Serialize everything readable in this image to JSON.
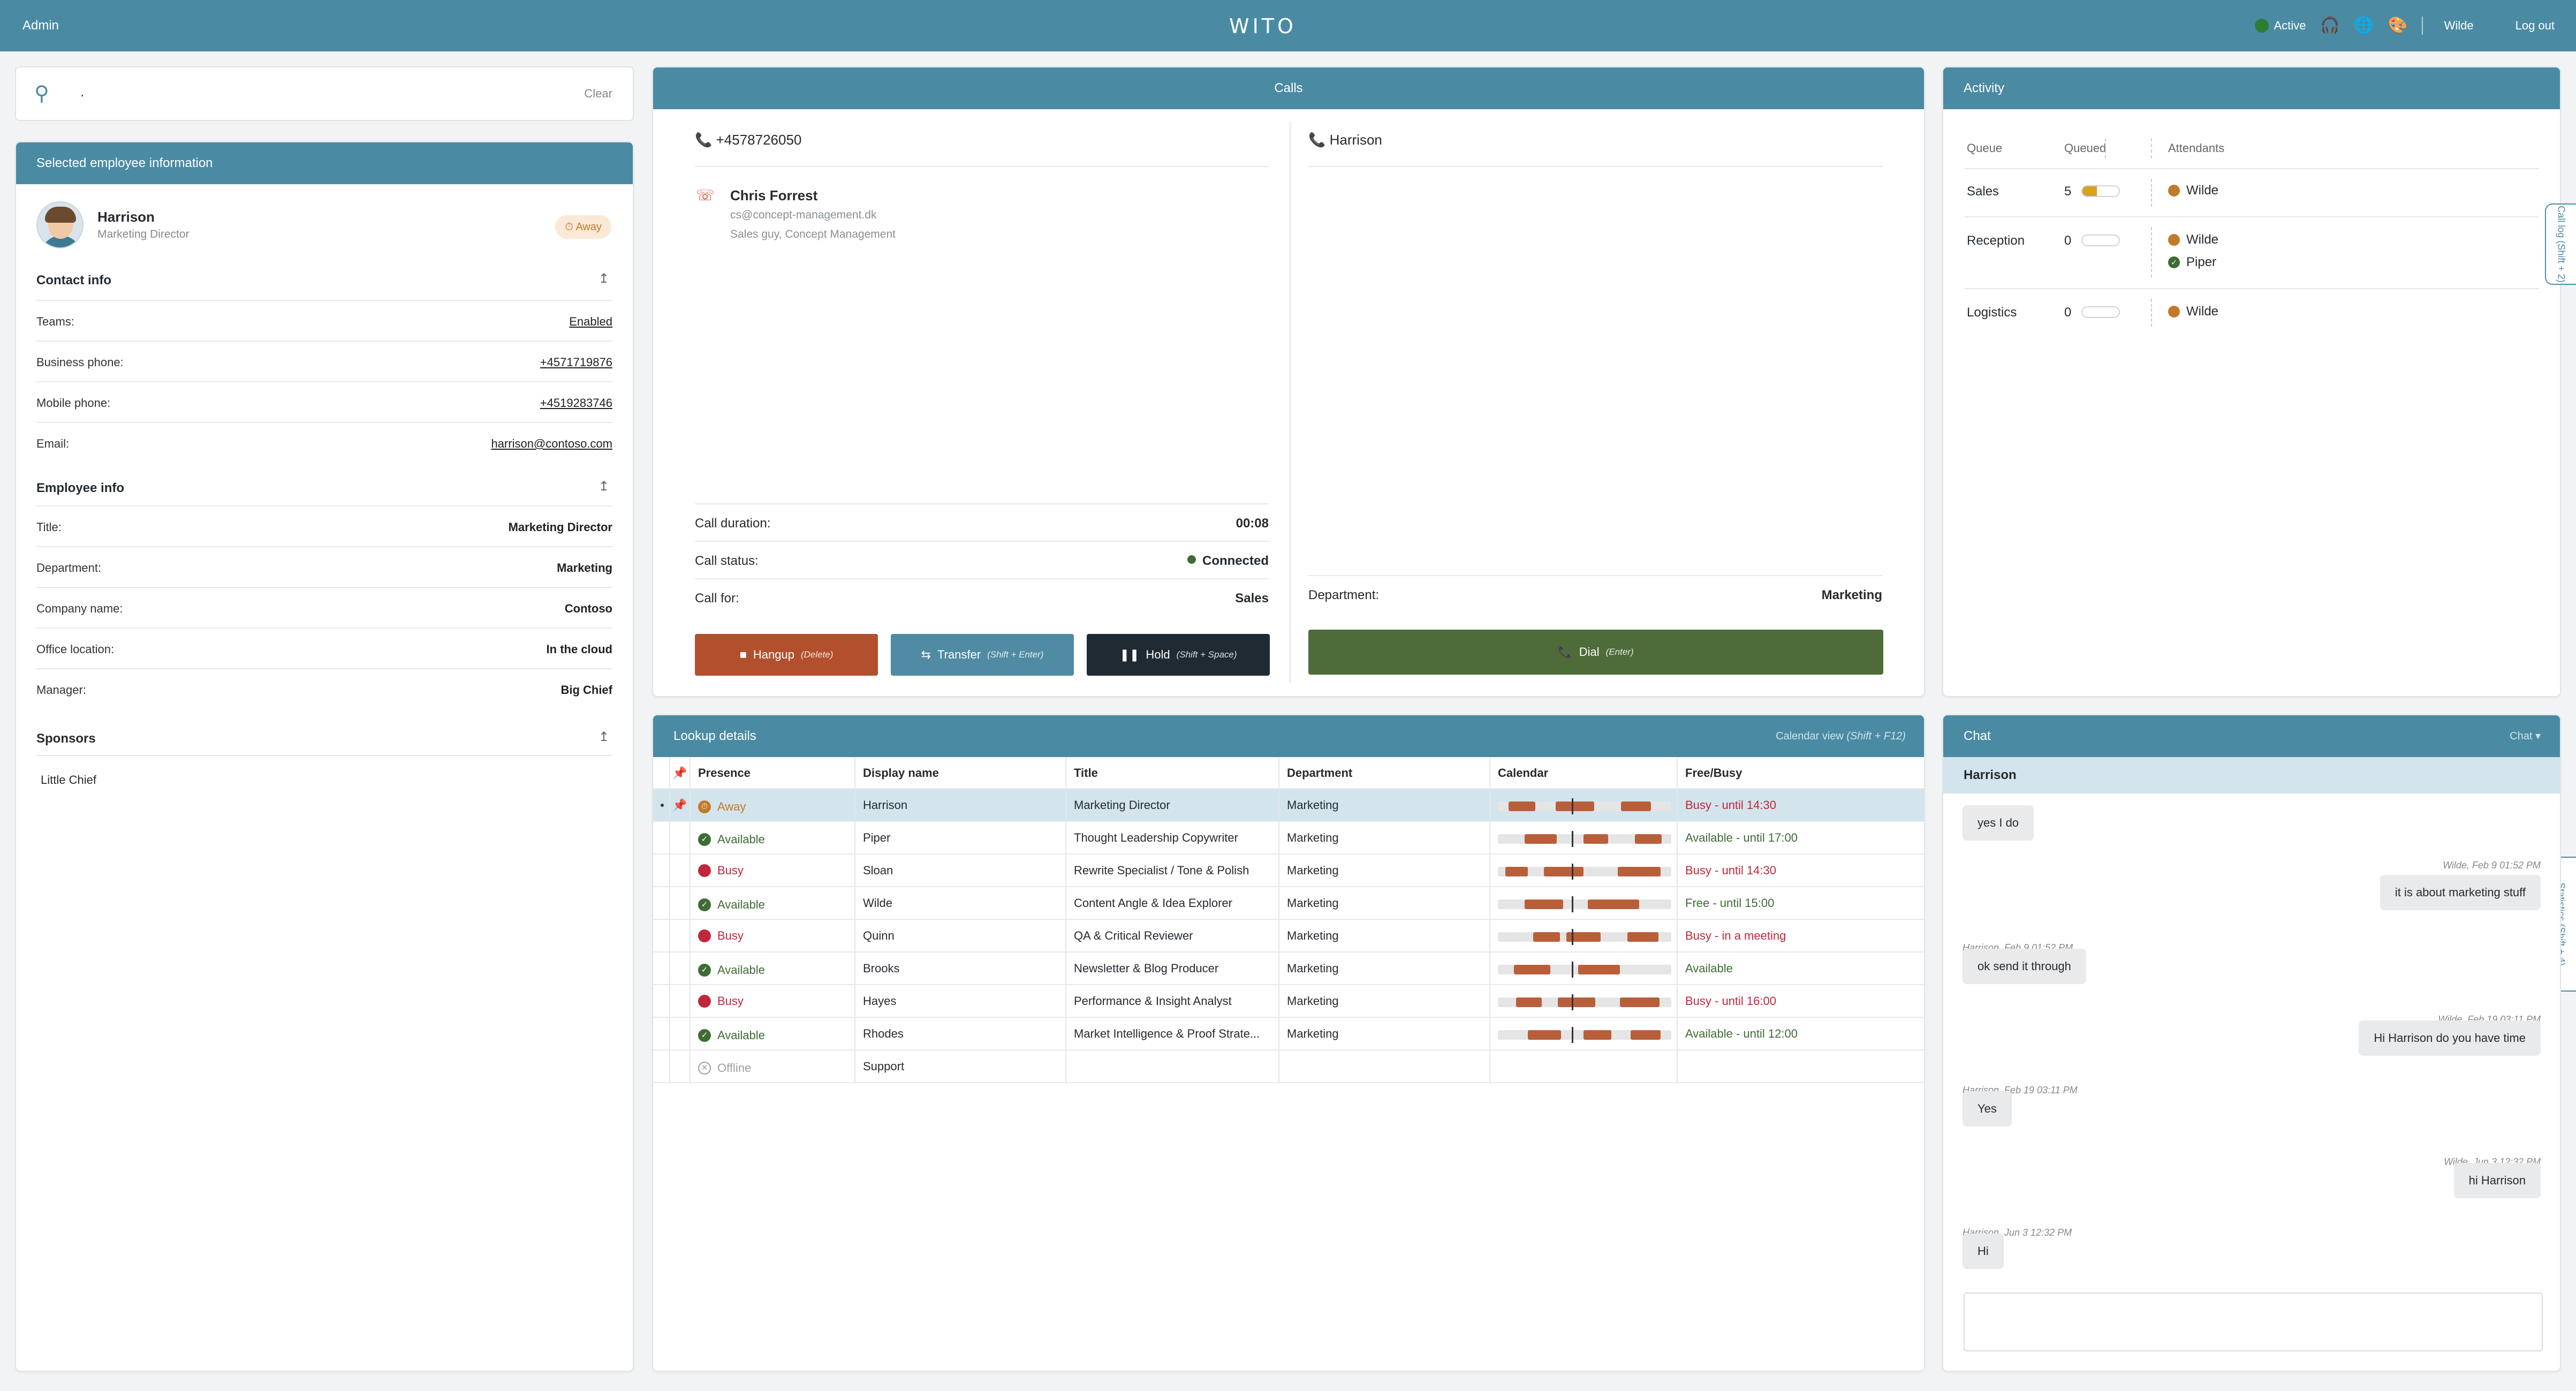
{
  "topbar": {
    "admin": "Admin",
    "logo": "WITO",
    "status": "Active",
    "user": "Wilde",
    "logout": "Log out"
  },
  "search": {
    "value": ".",
    "clear": "Clear"
  },
  "employee": {
    "header": "Selected employee information",
    "name": "Harrison",
    "title": "Marketing Director",
    "presence": "Away",
    "contact_title": "Contact info",
    "contact": [
      {
        "label": "Teams:",
        "value": "Enabled"
      },
      {
        "label": "Business phone:",
        "value": "+4571719876"
      },
      {
        "label": "Mobile phone:",
        "value": "+4519283746"
      },
      {
        "label": "Email:",
        "value": "harrison@contoso.com"
      }
    ],
    "info_title": "Employee info",
    "info": [
      {
        "label": "Title:",
        "value": "Marketing Director"
      },
      {
        "label": "Department:",
        "value": "Marketing"
      },
      {
        "label": "Company name:",
        "value": "Contoso"
      },
      {
        "label": "Office location:",
        "value": "In the cloud"
      },
      {
        "label": "Manager:",
        "value": "Big Chief"
      }
    ],
    "sponsors_title": "Sponsors",
    "sponsors": [
      "Little Chief"
    ]
  },
  "calls": {
    "header": "Calls",
    "left": {
      "number": "+4578726050",
      "caller_name": "Chris Forrest",
      "caller_email": "cs@concept-management.dk",
      "caller_role": "Sales guy, Concept Management",
      "details": [
        {
          "label": "Call duration:",
          "value": "00:08"
        },
        {
          "label": "Call status:",
          "value": "Connected"
        },
        {
          "label": "Call for:",
          "value": "Sales"
        }
      ],
      "buttons": {
        "hangup": "Hangup",
        "hangup_hint": "(Delete)",
        "transfer": "Transfer",
        "transfer_hint": "(Shift + Enter)",
        "hold": "Hold",
        "hold_hint": "(Shift + Space)"
      }
    },
    "right": {
      "name": "Harrison",
      "dept_label": "Department:",
      "dept_value": "Marketing",
      "dial": "Dial",
      "dial_hint": "(Enter)"
    }
  },
  "activity": {
    "header": "Activity",
    "cols": {
      "queue": "Queue",
      "queued": "Queued",
      "attendants": "Attendants"
    },
    "rows": [
      {
        "queue": "Sales",
        "queued": "5",
        "attendants": [
          "Wilde"
        ]
      },
      {
        "queue": "Reception",
        "queued": "0",
        "attendants": [
          "Wilde",
          "Piper"
        ]
      },
      {
        "queue": "Logistics",
        "queued": "0",
        "attendants": [
          "Wilde"
        ]
      }
    ],
    "queue_fill": [
      0.4,
      0,
      0
    ]
  },
  "side_tabs": {
    "call_log": "Call log (Shift + 2)",
    "statistics": "Statistics (Shift + 4)"
  },
  "lookup": {
    "header": "Lookup details",
    "calendar_view": "Calendar view",
    "calendar_hint": "(Shift + F12)",
    "cols": {
      "presence": "Presence",
      "display_name": "Display name",
      "title": "Title",
      "department": "Department",
      "calendar": "Calendar",
      "freebusy": "Free/Busy"
    },
    "rows": [
      {
        "presence": "Away",
        "name": "Harrison",
        "title": "Marketing Director",
        "dept": "Marketing",
        "freebusy": "Busy - until 14:30"
      },
      {
        "presence": "Available",
        "name": "Piper",
        "title": "Thought Leadership Copywriter",
        "dept": "Marketing",
        "freebusy": "Available - until 17:00"
      },
      {
        "presence": "Busy",
        "name": "Sloan",
        "title": "Rewrite Specialist / Tone & Polish",
        "dept": "Marketing",
        "freebusy": "Busy - until 14:30"
      },
      {
        "presence": "Available",
        "name": "Wilde",
        "title": "Content Angle & Idea Explorer",
        "dept": "Marketing",
        "freebusy": "Free - until 15:00"
      },
      {
        "presence": "Busy",
        "name": "Quinn",
        "title": "QA & Critical Reviewer",
        "dept": "Marketing",
        "freebusy": "Busy - in a meeting"
      },
      {
        "presence": "Available",
        "name": "Brooks",
        "title": "Newsletter & Blog Producer",
        "dept": "Marketing",
        "freebusy": "Available"
      },
      {
        "presence": "Busy",
        "name": "Hayes",
        "title": "Performance & Insight Analyst",
        "dept": "Marketing",
        "freebusy": "Busy - until 16:00"
      },
      {
        "presence": "Available",
        "name": "Rhodes",
        "title": "Market Intelligence & Proof Strate...",
        "dept": "Marketing",
        "freebusy": "Available - until 12:00"
      },
      {
        "presence": "Offline",
        "name": "Support",
        "title": "",
        "dept": "",
        "freebusy": ""
      }
    ]
  },
  "chat": {
    "header": "Chat",
    "menu": "Chat ▾",
    "user": "Harrison",
    "messages": [
      {
        "from": "them",
        "meta": "",
        "text": "yes I do"
      },
      {
        "from": "me",
        "meta": "Wilde, Feb 9 01:52 PM",
        "text": "it is about marketing stuff"
      },
      {
        "from": "them",
        "meta": "Harrison, Feb 9 01:52 PM",
        "text": "ok send it through"
      },
      {
        "from": "me",
        "meta": "Wilde, Feb 19 03:11 PM",
        "text": "Hi Harrison do you have time"
      },
      {
        "from": "them",
        "meta": "Harrison, Feb 19 03:11 PM",
        "text": "Yes"
      },
      {
        "from": "me",
        "meta": "Wilde, Jun 3 12:32 PM",
        "text": "hi Harrison"
      },
      {
        "from": "them",
        "meta": "Harrison, Jun 3 12:32 PM",
        "text": "Hi"
      }
    ]
  },
  "colors": {
    "brand": "#4a8ba3",
    "away": "#c27a2a",
    "available": "#3f6b35",
    "busy": "#c0273d",
    "offline": "#9aa0a5",
    "hangup": "#b2502d",
    "transfer": "#4f8ba2",
    "hold": "#1f2a33",
    "dial": "#4e6b3a"
  }
}
